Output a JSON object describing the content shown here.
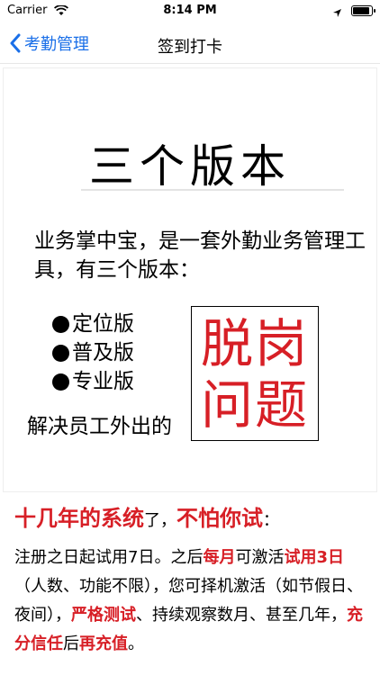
{
  "status_bar": {
    "carrier": "Carrier",
    "time": "8:14 PM",
    "icons": [
      "wifi-icon",
      "location-arrow-icon",
      "battery-icon"
    ]
  },
  "nav": {
    "back_label": "考勤管理",
    "title": "签到打卡"
  },
  "content": {
    "heading": "三个版本",
    "intro": "业务掌中宝，是一套外勤业务管理工具，有三个版本：",
    "versions": [
      "定位版",
      "普及版",
      "专业版"
    ],
    "solve_text": "解决员工外出的",
    "stamp": {
      "line1": "脱岗",
      "line2": "问题"
    },
    "promo": {
      "head_a": "十几年的系统",
      "head_b": "了，",
      "head_c": "不怕你试",
      "head_d": "：",
      "p1": "注册之日起试用7日。之后",
      "p1_hl1": "每月",
      "p1_b": "可激活",
      "p1_hl2": "试用3日",
      "p2": "（人数、功能不限），您可择机激活（如节假日、夜间），",
      "p2_hl1": "严格测试",
      "p2_b": "、持续观察数月、甚至几年，",
      "p2_hl2": "充分信任",
      "p2_c": "后",
      "p2_hl3": "再充值",
      "p2_d": "。"
    },
    "accent_color": "#d71f26",
    "link_color": "#1a6fe8"
  }
}
